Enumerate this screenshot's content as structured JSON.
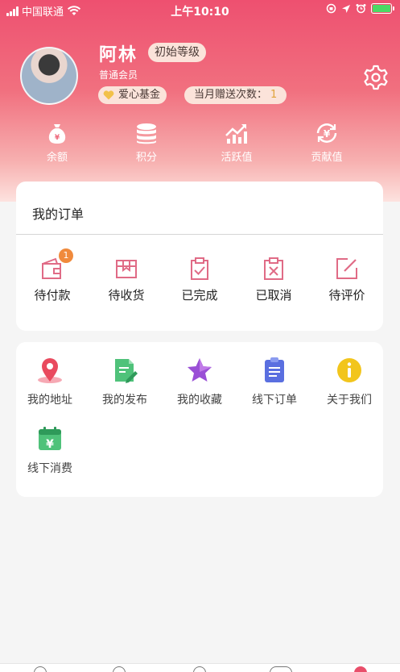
{
  "status_bar": {
    "carrier": "中国联通",
    "time": "上午10:10"
  },
  "profile": {
    "name": "阿林",
    "level": "初始等级",
    "member_type": "普通会员",
    "fund_label": "爱心基金",
    "gift_label": "当月赠送次数：",
    "gift_count": "1"
  },
  "stats": [
    {
      "label": "余额",
      "icon": "money-bag-icon"
    },
    {
      "label": "积分",
      "icon": "coins-stack-icon"
    },
    {
      "label": "活跃值",
      "icon": "trend-chart-icon"
    },
    {
      "label": "贡献值",
      "icon": "yen-refresh-icon"
    }
  ],
  "orders": {
    "title": "我的订单",
    "items": [
      {
        "label": "待付款",
        "badge": "1"
      },
      {
        "label": "待收货"
      },
      {
        "label": "已完成"
      },
      {
        "label": "已取消"
      },
      {
        "label": "待评价"
      }
    ]
  },
  "services": {
    "items": [
      {
        "label": "我的地址"
      },
      {
        "label": "我的发布"
      },
      {
        "label": "我的收藏"
      },
      {
        "label": "线下订单"
      },
      {
        "label": "关于我们"
      },
      {
        "label": "线下消费"
      }
    ]
  },
  "colors": {
    "accent": "#e94e6a",
    "order_icon": "#e06b86",
    "badge": "#f08a3c"
  }
}
